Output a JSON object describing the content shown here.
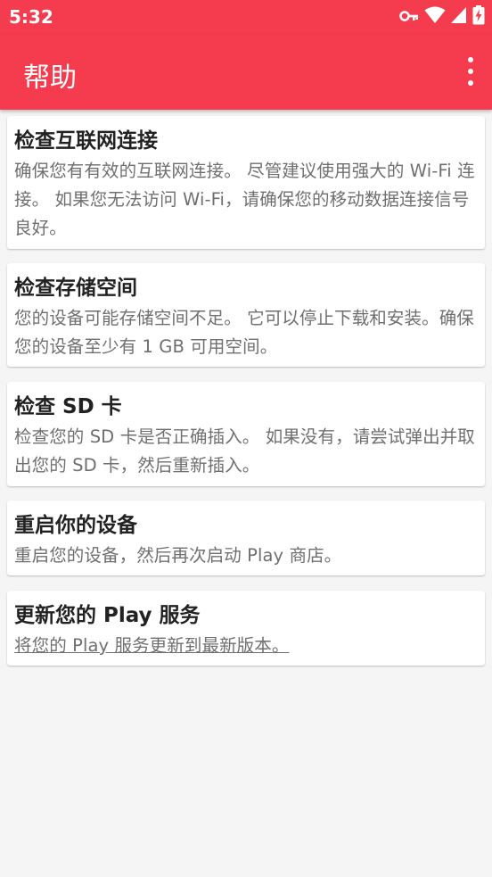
{
  "status_bar": {
    "time": "5:32",
    "icons": [
      "vpn-key-icon",
      "wifi-icon",
      "signal-icon",
      "battery-charging-icon"
    ]
  },
  "app_bar": {
    "title": "帮助",
    "menu_icon": "more-vert-icon"
  },
  "colors": {
    "accent": "#f53c4e",
    "background": "#f5f5f5",
    "card": "#ffffff",
    "title_text": "#222222",
    "body_text": "#6f6f6f"
  },
  "cards": [
    {
      "title": "检查互联网连接",
      "body": "确保您有有效的互联网连接。 尽管建议使用强大的 Wi-Fi 连接。 如果您无法访问 Wi-Fi，请确保您的移动数据连接信号良好。"
    },
    {
      "title": "检查存储空间",
      "body": "您的设备可能存储空间不足。 它可以停止下载和安装。确保您的设备至少有 1 GB 可用空间。"
    },
    {
      "title": "检查 SD 卡",
      "body": "检查您的 SD 卡是否正确插入。 如果没有，请尝试弹出并取出您的 SD 卡，然后重新插入。"
    },
    {
      "title": "重启你的设备",
      "body": "重启您的设备，然后再次启动 Play 商店。"
    },
    {
      "title": "更新您的 Play 服务",
      "body": "将您的 Play 服务更新到最新版本。"
    }
  ]
}
